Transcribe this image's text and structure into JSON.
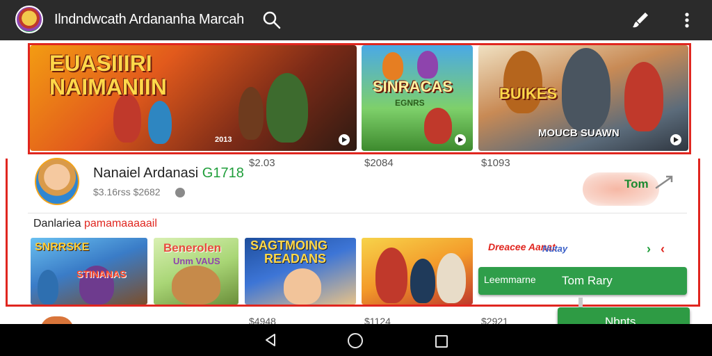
{
  "app": {
    "title": "Ilndndwcath Ardananha Marcah",
    "icons": {
      "logo": "app-logo",
      "search": "search-icon",
      "edit": "edit-brush-icon",
      "menu": "more-vert-icon"
    }
  },
  "banner": {
    "hero1": {
      "title": "EUASIIIRI NAIMANIIN",
      "badge": "2013"
    },
    "hero2": {
      "title": "SINRACAS",
      "subtitle": "EGNRS"
    },
    "hero3": {
      "title": "BUIKES",
      "subtitle": "MOUCB SUAWN"
    }
  },
  "profile": {
    "name": "Nanaiel Ardanasi",
    "name_number": "G1718",
    "subline": "$3.16rss $2682",
    "prices": [
      "$2.03",
      "$2084",
      "$1093"
    ],
    "action_label": "Tom"
  },
  "section": {
    "label": "Danlariea",
    "label_red": "pamamaaaaail"
  },
  "cards": [
    {
      "title": "SNRRSKE",
      "subtitle": "STINANAS"
    },
    {
      "title": "Benerolen",
      "subtitle": "Unm VAUS"
    },
    {
      "title": "SAGTMOING",
      "subtitle": "READANS"
    },
    {
      "title": ""
    }
  ],
  "side": {
    "title": "Dreacee Aanat",
    "tag": "Nutay",
    "label": "Leemmarne"
  },
  "buttons": {
    "primary": "Tom Rary",
    "secondary": "Nbnts"
  },
  "next_row": {
    "prices": [
      "$4948",
      "$1124",
      "$2921"
    ]
  },
  "colors": {
    "accent_green": "#2f9e4a",
    "outline_red": "#e0261f",
    "appbar": "#2b2b2b"
  },
  "system_nav": {
    "back": "back-icon",
    "home": "home-icon",
    "recent": "recent-apps-icon"
  }
}
